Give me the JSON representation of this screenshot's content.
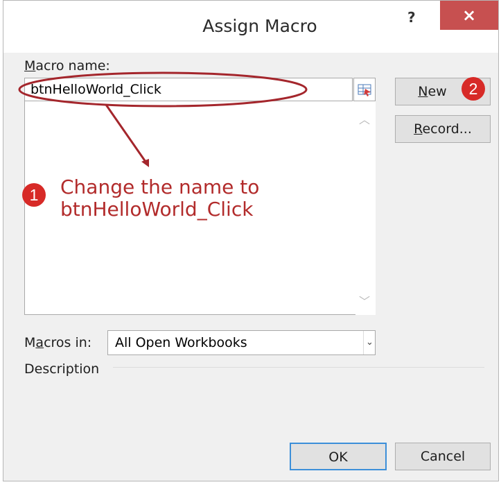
{
  "title": "Assign Macro",
  "help_label": "?",
  "close_label": "×",
  "macro_name": {
    "label_prefix": "M",
    "label_rest": "acro name:",
    "value": "btnHelloWorld_Click"
  },
  "buttons": {
    "new_prefix": "N",
    "new_rest": "ew",
    "record_prefix": "R",
    "record_rest": "ecord...",
    "ok": "OK",
    "cancel": "Cancel"
  },
  "macros_in": {
    "label_before": "M",
    "label_u": "a",
    "label_after": "cros in:",
    "selected": "All Open Workbooks"
  },
  "description_label": "Description",
  "annotation": {
    "line1": "Change the name to",
    "line2": "btnHelloWorld_Click",
    "badge1": "1",
    "badge2": "2",
    "color": "#b22b2b"
  }
}
